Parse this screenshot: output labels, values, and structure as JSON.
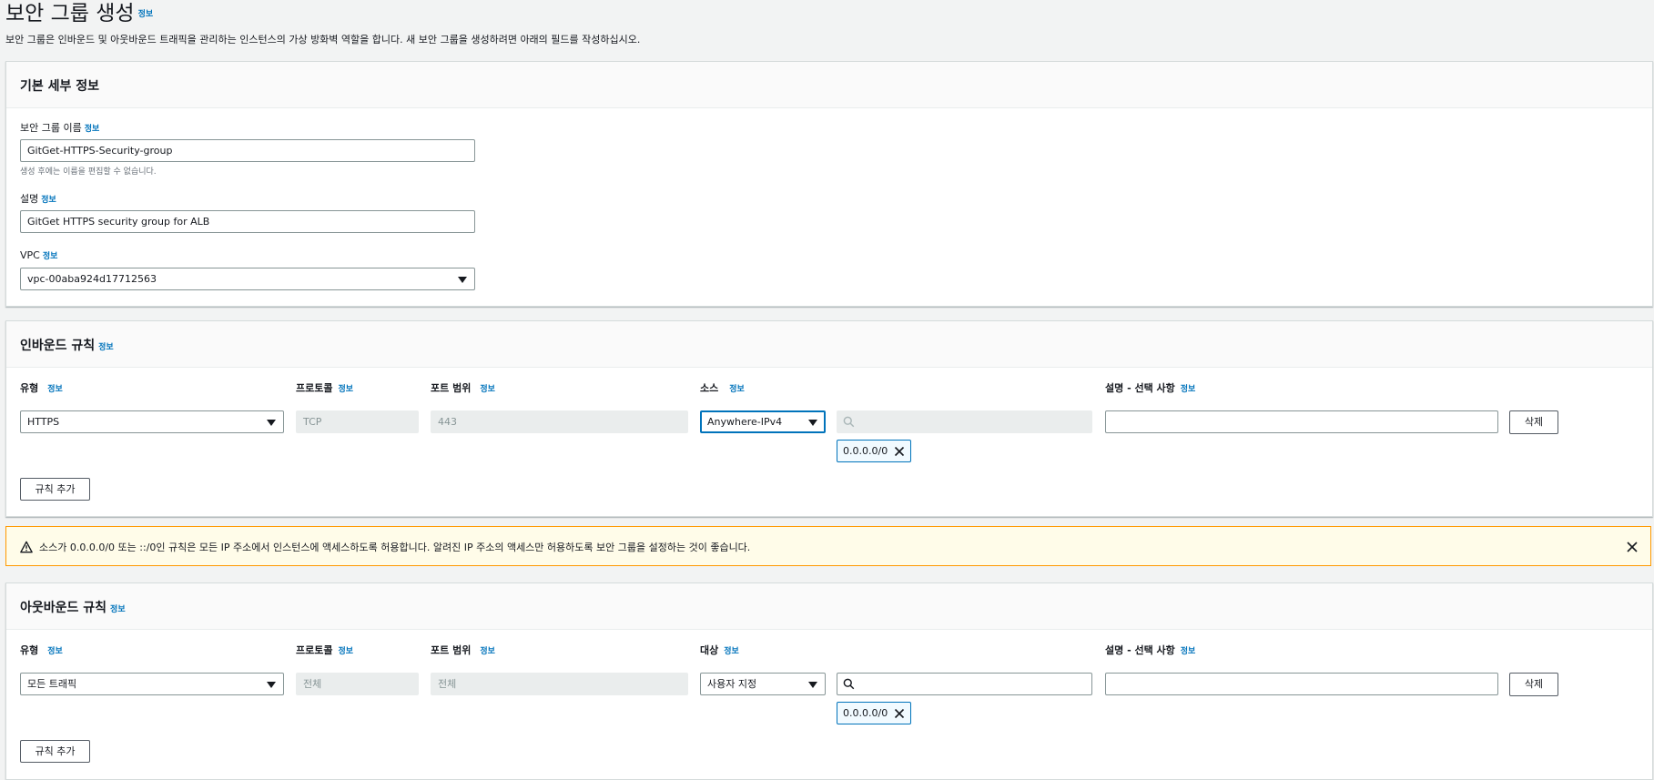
{
  "header": {
    "title": "보안 그룹 생성",
    "info": "정보",
    "description": "보안 그룹은 인바운드 및 아웃바운드 트래픽을 관리하는 인스턴스의 가상 방화벽 역할을 합니다. 새 보안 그룹을 생성하려면 아래의 필드를 작성하십시오."
  },
  "basic": {
    "title": "기본 세부 정보",
    "name_label": "보안 그룹 이름",
    "name_info": "정보",
    "name_value": "GitGet-HTTPS-Security-group",
    "name_hint": "생성 후에는 이름을 편집할 수 없습니다.",
    "desc_label": "설명",
    "desc_info": "정보",
    "desc_value": "GitGet HTTPS security group for ALB",
    "vpc_label": "VPC",
    "vpc_info": "정보",
    "vpc_value": "vpc-00aba924d17712563"
  },
  "inbound": {
    "title": "인바운드 규칙",
    "info": "정보",
    "col_type": "유형",
    "col_protocol": "프로토콜",
    "col_port": "포트 범위",
    "col_source": "소스",
    "col_desc": "설명 - 선택 사항",
    "col_info": "정보",
    "type_value": "HTTPS",
    "protocol_value": "TCP",
    "port_value": "443",
    "source_value": "Anywhere-IPv4",
    "search_value": "",
    "desc_value": "",
    "token": "0.0.0.0/0",
    "delete_label": "삭제",
    "add_label": "규칙 추가"
  },
  "warning": {
    "text": "소스가 0.0.0.0/0 또는 ::/0인 규칙은 모든 IP 주소에서 인스턴스에 액세스하도록 허용합니다. 알려진 IP 주소의 액세스만 허용하도록 보안 그룹을 설정하는 것이 좋습니다."
  },
  "outbound": {
    "title": "아웃바운드 규칙",
    "info": "정보",
    "col_type": "유형",
    "col_protocol": "프로토콜",
    "col_port": "포트 범위",
    "col_dest": "대상",
    "col_desc": "설명 - 선택 사항",
    "col_info": "정보",
    "type_value": "모든 트래픽",
    "protocol_value": "전체",
    "port_value": "전체",
    "dest_value": "사용자 지정",
    "search_value": "",
    "desc_value": "",
    "token": "0.0.0.0/0",
    "delete_label": "삭제",
    "add_label": "규칙 추가"
  },
  "colors": {
    "link": "#0073bb",
    "warning_border": "#ff9900",
    "warning_bg": "#fffce9"
  },
  "icons": [
    "warning-icon",
    "close-icon",
    "search-icon",
    "caret-down-icon",
    "remove-token-icon"
  ]
}
